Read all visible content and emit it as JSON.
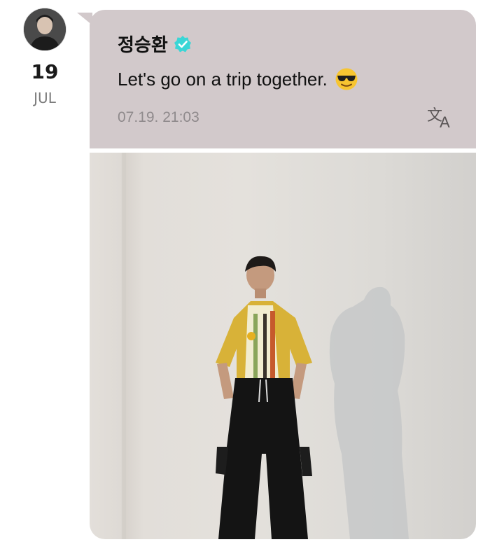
{
  "post": {
    "date_day": "19",
    "date_month": "JUL",
    "author_name": "정승환",
    "message": "Let's go on a trip together.",
    "message_emoji": "smiling-face-with-sunglasses-icon",
    "timestamp": "07.19. 21:03"
  },
  "colors": {
    "bubble_bg": "#d2c9cb",
    "verified_badge": "#3ad6d6",
    "timestamp_text": "#8f8a8c",
    "month_text": "#7a7a7a"
  },
  "icons": {
    "avatar": "avatar-photo",
    "verified": "verified-badge-icon",
    "translate": "translate-icon",
    "emoji": "smiling-face-with-sunglasses-icon"
  }
}
